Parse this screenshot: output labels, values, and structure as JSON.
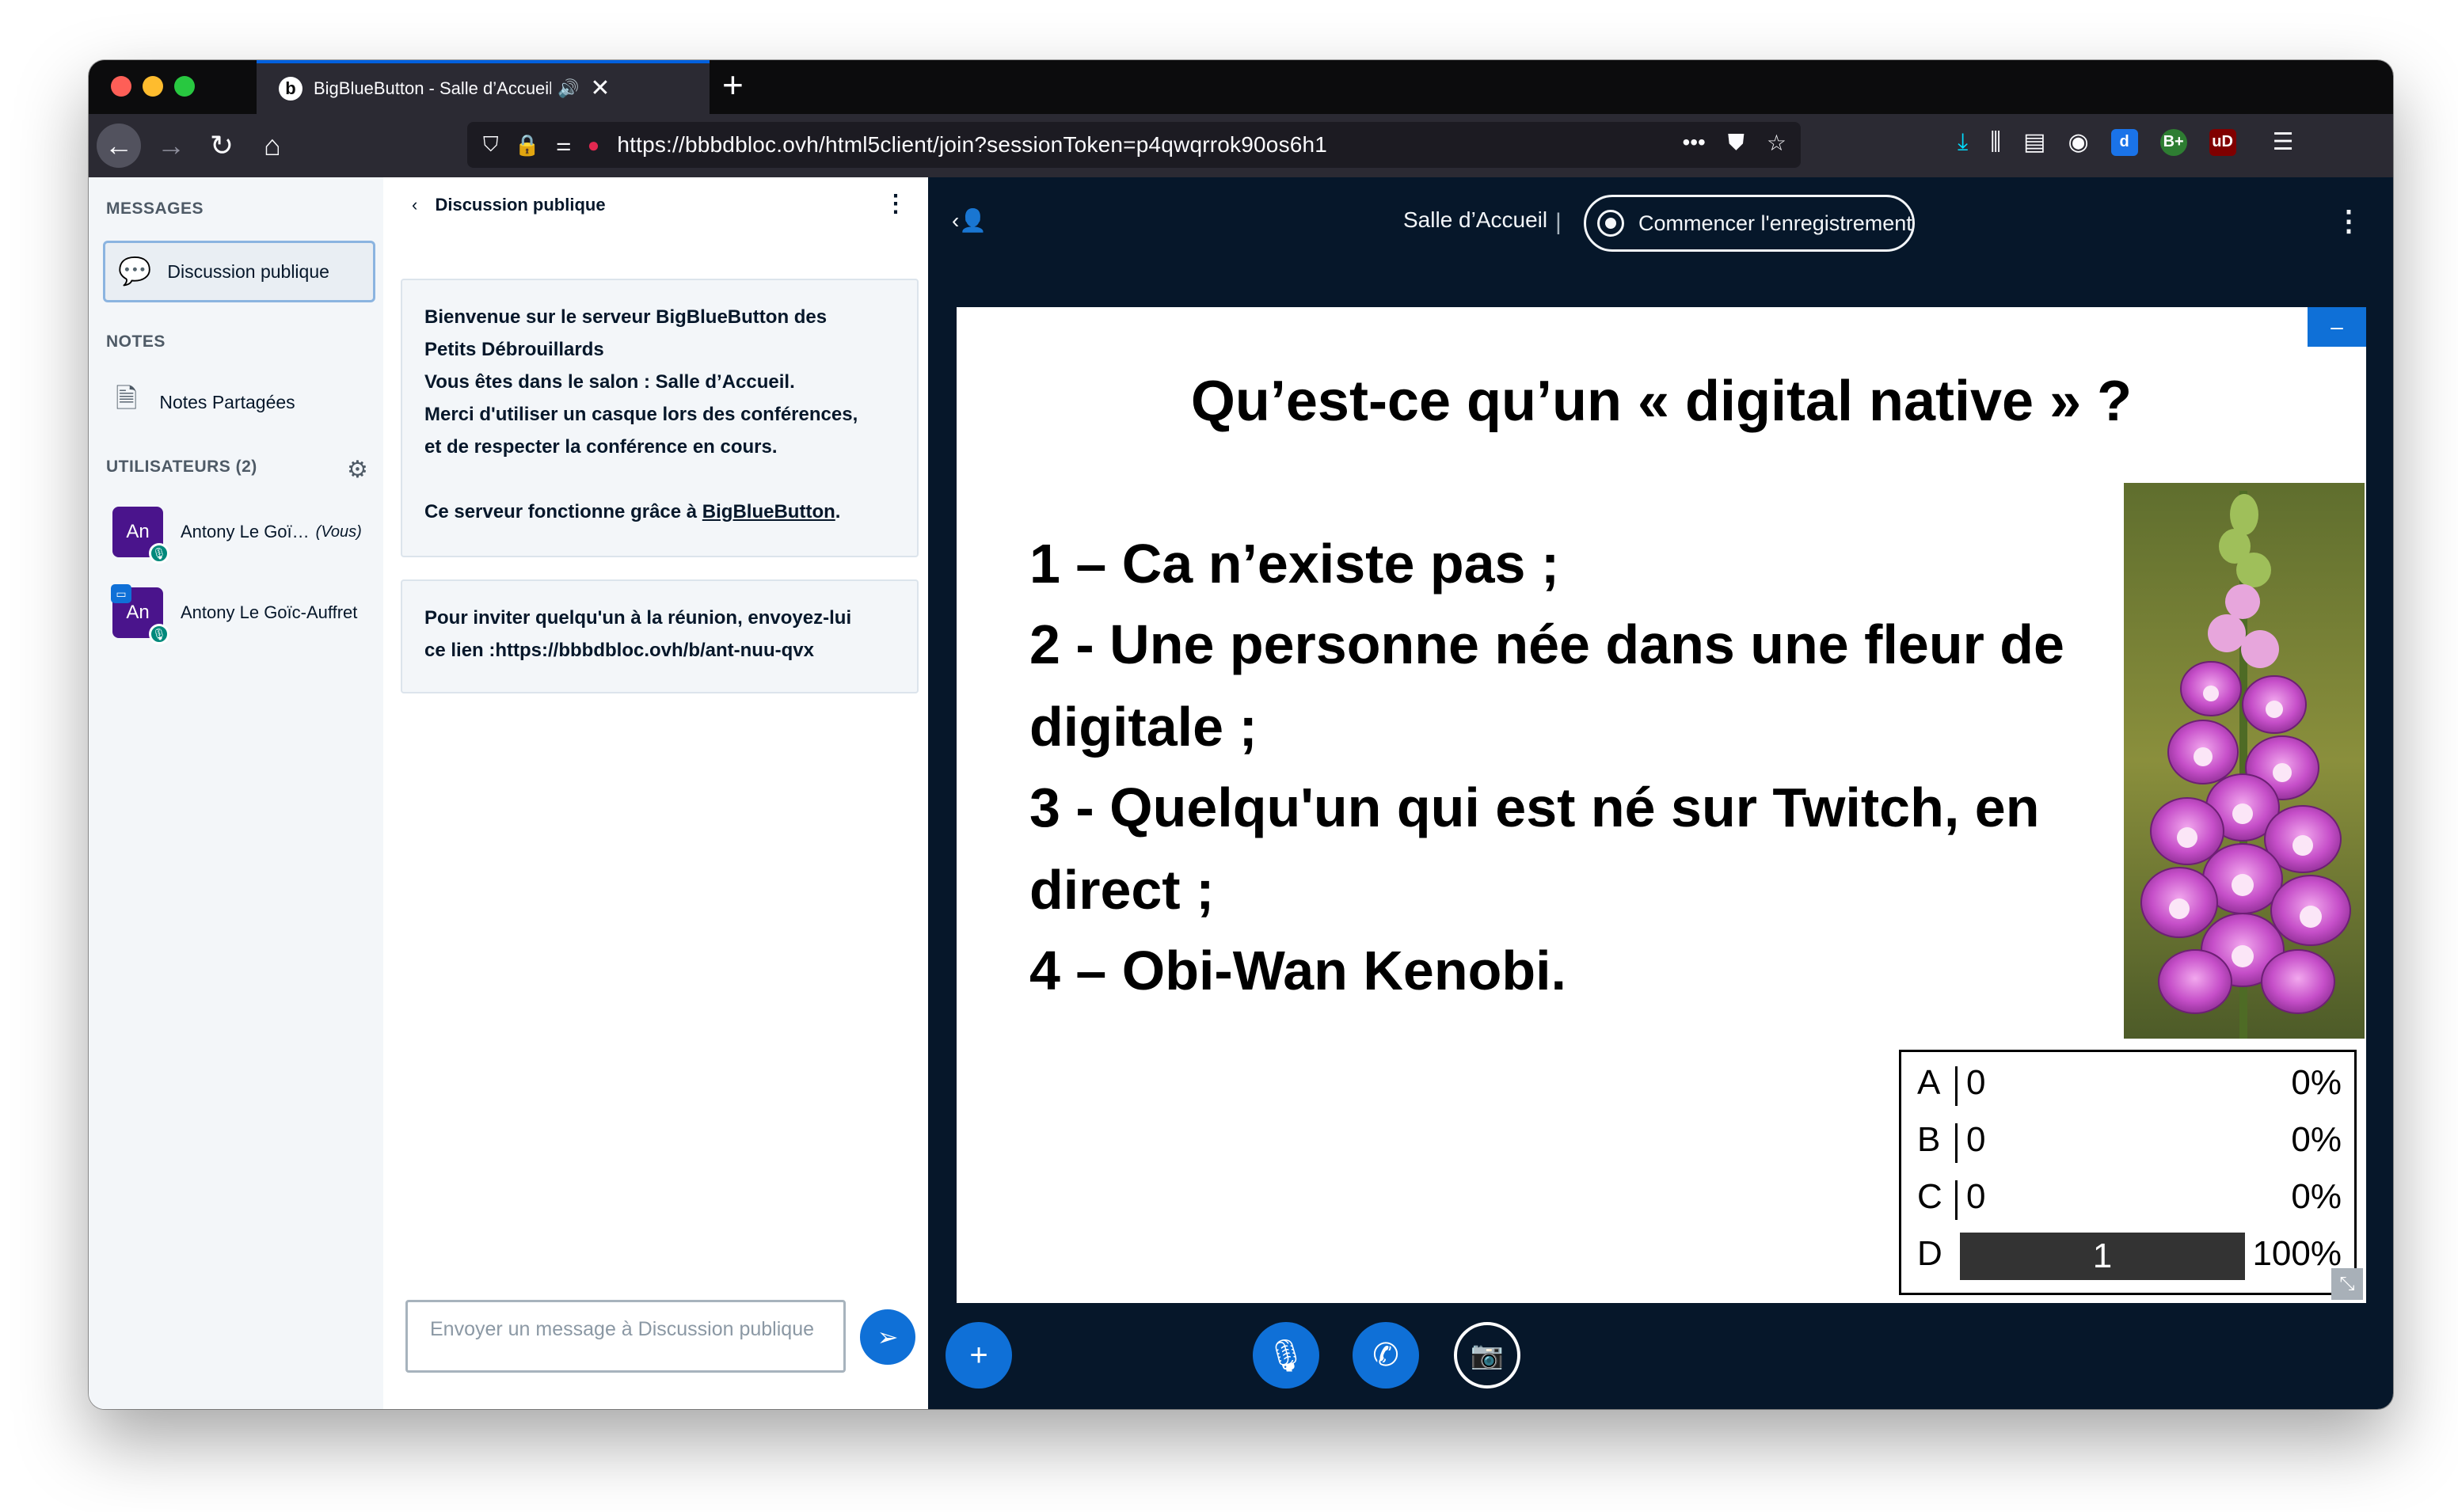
{
  "browser": {
    "tab_title": "BigBlueButton - Salle d’Accueil",
    "tab_favicon": "b",
    "url": "https://bbbdbloc.ovh/html5client/join?sessionToken=p4qwqrrok90os6h1",
    "url_overflow": "•••",
    "extensions": [
      {
        "label": "d",
        "color": "#1a73e8"
      },
      {
        "label": "B+",
        "color": "#2e7d32"
      },
      {
        "label": "uD",
        "color": "#800000"
      }
    ]
  },
  "sidebar": {
    "messages_title": "MESSAGES",
    "public_chat_label": "Discussion publique",
    "notes_title": "NOTES",
    "shared_notes_label": "Notes Partagées",
    "users_title": "UTILISATEURS (2)",
    "users": [
      {
        "initials": "An",
        "name": "Antony Le Goï…",
        "you_label": "(Vous)"
      },
      {
        "initials": "An",
        "name": "Antony Le Goïc-Auffret",
        "you_label": ""
      }
    ]
  },
  "chat": {
    "header": "Discussion publique",
    "welcome": {
      "line1": "Bienvenue sur le serveur BigBlueButton des",
      "line2": "Petits Débrouillards",
      "line3_prefix": "Vous êtes dans le salon : ",
      "line3_room": "Salle d’Accueil",
      "line3_suffix": ".",
      "line4": "Merci d'utiliser un casque lors des conférences,",
      "line5": "et de respecter la conférence en cours.",
      "line6_prefix": "Ce serveur fonctionne grâce à ",
      "line6_link": "BigBlueButton",
      "line6_suffix": "."
    },
    "invite": {
      "line1": "Pour inviter quelqu'un à la réunion, envoyez-lui",
      "line2": "ce lien :https://bbbdbloc.ovh/b/ant-nuu-qvx"
    },
    "input_placeholder": "Envoyer un message à Discussion publique"
  },
  "main": {
    "meeting_title": "Salle d’Accueil",
    "separator": "|",
    "record_label": "Commencer l'enregistrement"
  },
  "slide": {
    "title": "Qu’est-ce qu’un « digital native » ?",
    "lines": [
      "1 – Ca n’existe pas ;",
      "2 - Une personne née dans une fleur de",
      "digitale ;",
      "3 - Quelqu'un qui est né sur Twitch, en",
      "direct ;",
      "4 – Obi-Wan Kenobi."
    ]
  },
  "poll": {
    "rows": [
      {
        "letter": "A",
        "count": "0",
        "percent": "0%",
        "fraction": 0
      },
      {
        "letter": "B",
        "count": "0",
        "percent": "0%",
        "fraction": 0
      },
      {
        "letter": "C",
        "count": "0",
        "percent": "0%",
        "fraction": 0
      },
      {
        "letter": "D",
        "count": "1",
        "percent": "100%",
        "fraction": 1
      }
    ]
  },
  "colors": {
    "accent": "#0f70d7",
    "main_bg": "#06172a",
    "avatar": "#4a148c"
  }
}
